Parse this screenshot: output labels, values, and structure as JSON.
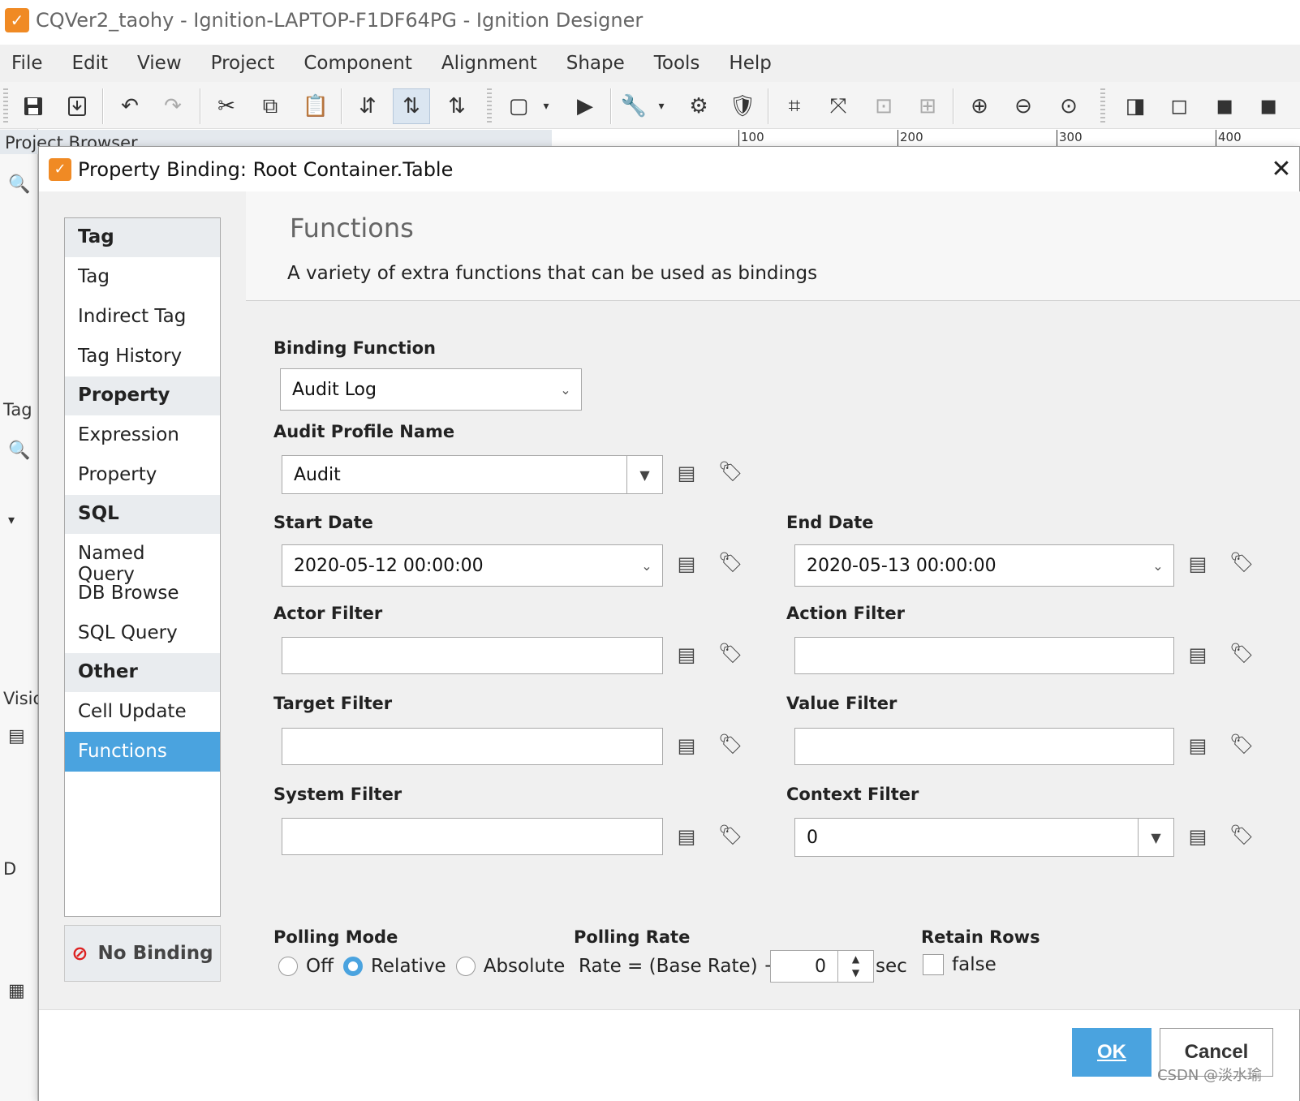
{
  "window": {
    "title": "CQVer2_taohy - Ignition-LAPTOP-F1DF64PG - Ignition Designer"
  },
  "menu": [
    "File",
    "Edit",
    "View",
    "Project",
    "Component",
    "Alignment",
    "Shape",
    "Tools",
    "Help"
  ],
  "panes": {
    "project_browser": "Project Browser",
    "tag_label": "Tag",
    "vision_label": "Visio",
    "d_label": "D"
  },
  "ruler": [
    "100",
    "200",
    "300",
    "400"
  ],
  "dialog": {
    "title": "Property Binding: Root Container.Table",
    "close": "✕",
    "categories": [
      {
        "name": "Tag",
        "options": [
          "Tag",
          "Indirect Tag",
          "Tag History"
        ]
      },
      {
        "name": "Property",
        "options": [
          "Expression",
          "Property"
        ]
      },
      {
        "name": "SQL",
        "options": [
          "Named Query",
          "DB Browse",
          "SQL Query"
        ]
      },
      {
        "name": "Other",
        "options": [
          "Cell Update",
          "Functions"
        ]
      }
    ],
    "selected_option": "Functions",
    "no_binding": "No Binding",
    "content": {
      "title": "Functions",
      "description": "A variety of extra functions that can be used as bindings",
      "binding_function_label": "Binding Function",
      "binding_function_value": "Audit Log",
      "audit_profile_label": "Audit Profile Name",
      "audit_profile_value": "Audit",
      "start_date_label": "Start Date",
      "start_date_value": "2020-05-12 00:00:00",
      "end_date_label": "End Date",
      "end_date_value": "2020-05-13 00:00:00",
      "actor_filter_label": "Actor Filter",
      "actor_filter_value": "",
      "action_filter_label": "Action Filter",
      "action_filter_value": "",
      "target_filter_label": "Target Filter",
      "target_filter_value": "",
      "value_filter_label": "Value Filter",
      "value_filter_value": "",
      "system_filter_label": "System Filter",
      "system_filter_value": "",
      "context_filter_label": "Context Filter",
      "context_filter_value": "0",
      "polling_mode_label": "Polling Mode",
      "polling_modes": [
        "Off",
        "Relative",
        "Absolute"
      ],
      "polling_mode_selected": "Relative",
      "polling_rate_label": "Polling Rate",
      "polling_rate_prefix": "Rate = (Base Rate) +/-",
      "polling_rate_value": "0",
      "polling_rate_unit": "sec",
      "retain_rows_label": "Retain Rows",
      "retain_rows_value": "false"
    },
    "ok": "OK",
    "cancel": "Cancel"
  },
  "watermark": "CSDN @淡水瑜",
  "colors": {
    "accent": "#4aa3df",
    "logo": "#f08a24",
    "no_binding_icon": "#dd2222"
  }
}
